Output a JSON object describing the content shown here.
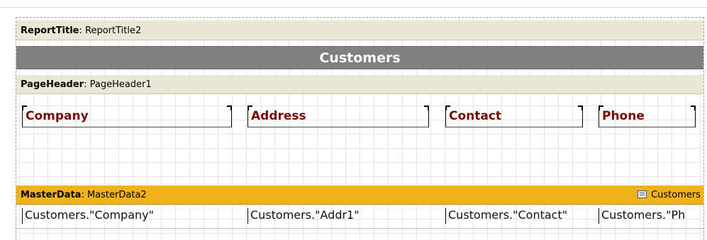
{
  "report_title_band": {
    "type": "ReportTitle",
    "name": "ReportTitle2"
  },
  "title_text": "Customers",
  "page_header_band": {
    "type": "PageHeader",
    "name": "PageHeader1"
  },
  "columns": [
    "Company",
    "Address",
    "Contact",
    "Phone"
  ],
  "master_band": {
    "type": "MasterData",
    "name": "MasterData2",
    "dataset": "Customers",
    "dataset_icon": "database-table-icon"
  },
  "fields": [
    "Customers.\"Company\"",
    "Customers.\"Addr1\"",
    "Customers.\"Contact\"",
    "Customers.\"Ph"
  ],
  "colors": {
    "master_band": "#f0b21b",
    "header_band": "#ebe7d6",
    "title_bar": "#808080",
    "column_text": "#7a0a0a"
  }
}
